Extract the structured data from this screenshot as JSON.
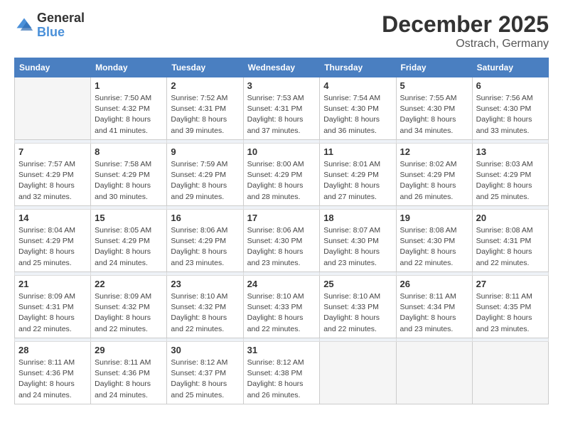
{
  "logo": {
    "text_general": "General",
    "text_blue": "Blue"
  },
  "title": {
    "month": "December 2025",
    "location": "Ostrach, Germany"
  },
  "headers": [
    "Sunday",
    "Monday",
    "Tuesday",
    "Wednesday",
    "Thursday",
    "Friday",
    "Saturday"
  ],
  "weeks": [
    [
      {
        "day": "",
        "sunrise": "",
        "sunset": "",
        "daylight": ""
      },
      {
        "day": "1",
        "sunrise": "Sunrise: 7:50 AM",
        "sunset": "Sunset: 4:32 PM",
        "daylight": "Daylight: 8 hours and 41 minutes."
      },
      {
        "day": "2",
        "sunrise": "Sunrise: 7:52 AM",
        "sunset": "Sunset: 4:31 PM",
        "daylight": "Daylight: 8 hours and 39 minutes."
      },
      {
        "day": "3",
        "sunrise": "Sunrise: 7:53 AM",
        "sunset": "Sunset: 4:31 PM",
        "daylight": "Daylight: 8 hours and 37 minutes."
      },
      {
        "day": "4",
        "sunrise": "Sunrise: 7:54 AM",
        "sunset": "Sunset: 4:30 PM",
        "daylight": "Daylight: 8 hours and 36 minutes."
      },
      {
        "day": "5",
        "sunrise": "Sunrise: 7:55 AM",
        "sunset": "Sunset: 4:30 PM",
        "daylight": "Daylight: 8 hours and 34 minutes."
      },
      {
        "day": "6",
        "sunrise": "Sunrise: 7:56 AM",
        "sunset": "Sunset: 4:30 PM",
        "daylight": "Daylight: 8 hours and 33 minutes."
      }
    ],
    [
      {
        "day": "7",
        "sunrise": "Sunrise: 7:57 AM",
        "sunset": "Sunset: 4:29 PM",
        "daylight": "Daylight: 8 hours and 32 minutes."
      },
      {
        "day": "8",
        "sunrise": "Sunrise: 7:58 AM",
        "sunset": "Sunset: 4:29 PM",
        "daylight": "Daylight: 8 hours and 30 minutes."
      },
      {
        "day": "9",
        "sunrise": "Sunrise: 7:59 AM",
        "sunset": "Sunset: 4:29 PM",
        "daylight": "Daylight: 8 hours and 29 minutes."
      },
      {
        "day": "10",
        "sunrise": "Sunrise: 8:00 AM",
        "sunset": "Sunset: 4:29 PM",
        "daylight": "Daylight: 8 hours and 28 minutes."
      },
      {
        "day": "11",
        "sunrise": "Sunrise: 8:01 AM",
        "sunset": "Sunset: 4:29 PM",
        "daylight": "Daylight: 8 hours and 27 minutes."
      },
      {
        "day": "12",
        "sunrise": "Sunrise: 8:02 AM",
        "sunset": "Sunset: 4:29 PM",
        "daylight": "Daylight: 8 hours and 26 minutes."
      },
      {
        "day": "13",
        "sunrise": "Sunrise: 8:03 AM",
        "sunset": "Sunset: 4:29 PM",
        "daylight": "Daylight: 8 hours and 25 minutes."
      }
    ],
    [
      {
        "day": "14",
        "sunrise": "Sunrise: 8:04 AM",
        "sunset": "Sunset: 4:29 PM",
        "daylight": "Daylight: 8 hours and 25 minutes."
      },
      {
        "day": "15",
        "sunrise": "Sunrise: 8:05 AM",
        "sunset": "Sunset: 4:29 PM",
        "daylight": "Daylight: 8 hours and 24 minutes."
      },
      {
        "day": "16",
        "sunrise": "Sunrise: 8:06 AM",
        "sunset": "Sunset: 4:29 PM",
        "daylight": "Daylight: 8 hours and 23 minutes."
      },
      {
        "day": "17",
        "sunrise": "Sunrise: 8:06 AM",
        "sunset": "Sunset: 4:30 PM",
        "daylight": "Daylight: 8 hours and 23 minutes."
      },
      {
        "day": "18",
        "sunrise": "Sunrise: 8:07 AM",
        "sunset": "Sunset: 4:30 PM",
        "daylight": "Daylight: 8 hours and 23 minutes."
      },
      {
        "day": "19",
        "sunrise": "Sunrise: 8:08 AM",
        "sunset": "Sunset: 4:30 PM",
        "daylight": "Daylight: 8 hours and 22 minutes."
      },
      {
        "day": "20",
        "sunrise": "Sunrise: 8:08 AM",
        "sunset": "Sunset: 4:31 PM",
        "daylight": "Daylight: 8 hours and 22 minutes."
      }
    ],
    [
      {
        "day": "21",
        "sunrise": "Sunrise: 8:09 AM",
        "sunset": "Sunset: 4:31 PM",
        "daylight": "Daylight: 8 hours and 22 minutes."
      },
      {
        "day": "22",
        "sunrise": "Sunrise: 8:09 AM",
        "sunset": "Sunset: 4:32 PM",
        "daylight": "Daylight: 8 hours and 22 minutes."
      },
      {
        "day": "23",
        "sunrise": "Sunrise: 8:10 AM",
        "sunset": "Sunset: 4:32 PM",
        "daylight": "Daylight: 8 hours and 22 minutes."
      },
      {
        "day": "24",
        "sunrise": "Sunrise: 8:10 AM",
        "sunset": "Sunset: 4:33 PM",
        "daylight": "Daylight: 8 hours and 22 minutes."
      },
      {
        "day": "25",
        "sunrise": "Sunrise: 8:10 AM",
        "sunset": "Sunset: 4:33 PM",
        "daylight": "Daylight: 8 hours and 22 minutes."
      },
      {
        "day": "26",
        "sunrise": "Sunrise: 8:11 AM",
        "sunset": "Sunset: 4:34 PM",
        "daylight": "Daylight: 8 hours and 23 minutes."
      },
      {
        "day": "27",
        "sunrise": "Sunrise: 8:11 AM",
        "sunset": "Sunset: 4:35 PM",
        "daylight": "Daylight: 8 hours and 23 minutes."
      }
    ],
    [
      {
        "day": "28",
        "sunrise": "Sunrise: 8:11 AM",
        "sunset": "Sunset: 4:36 PM",
        "daylight": "Daylight: 8 hours and 24 minutes."
      },
      {
        "day": "29",
        "sunrise": "Sunrise: 8:11 AM",
        "sunset": "Sunset: 4:36 PM",
        "daylight": "Daylight: 8 hours and 24 minutes."
      },
      {
        "day": "30",
        "sunrise": "Sunrise: 8:12 AM",
        "sunset": "Sunset: 4:37 PM",
        "daylight": "Daylight: 8 hours and 25 minutes."
      },
      {
        "day": "31",
        "sunrise": "Sunrise: 8:12 AM",
        "sunset": "Sunset: 4:38 PM",
        "daylight": "Daylight: 8 hours and 26 minutes."
      },
      {
        "day": "",
        "sunrise": "",
        "sunset": "",
        "daylight": ""
      },
      {
        "day": "",
        "sunrise": "",
        "sunset": "",
        "daylight": ""
      },
      {
        "day": "",
        "sunrise": "",
        "sunset": "",
        "daylight": ""
      }
    ]
  ]
}
